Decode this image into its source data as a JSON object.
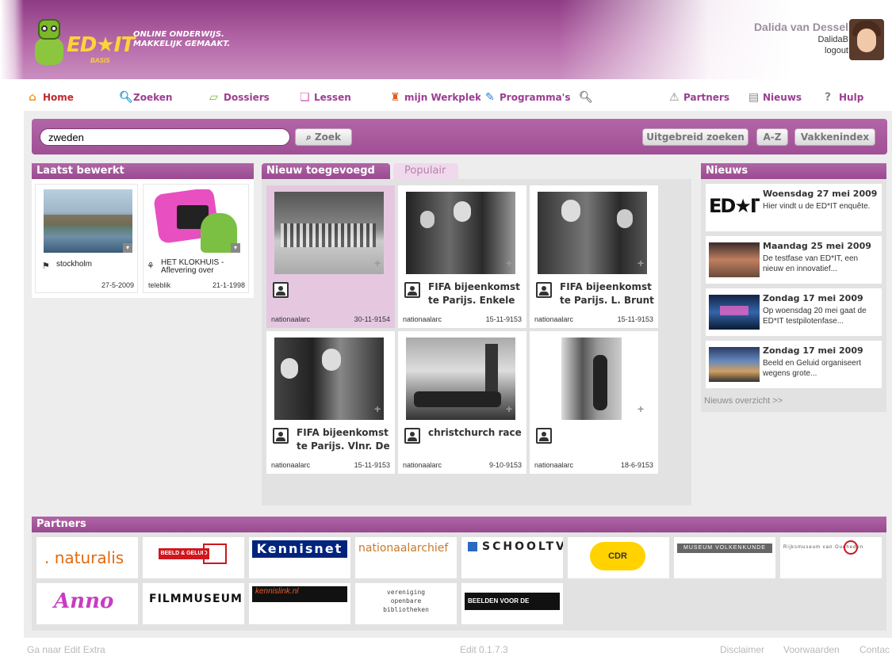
{
  "header": {
    "logo_text": "ED★IT",
    "logo_sub": "BASIS",
    "tagline_1": "ONLINE ONDERWIJS.",
    "tagline_2": "MAKKELIJK GEMAAKT.",
    "user_name": "Dalida van Dessel",
    "user_login": "DalidaB",
    "logout_label": "logout"
  },
  "tabs": [
    {
      "label": "Home",
      "icon": "house-icon"
    },
    {
      "label": "Zoeken",
      "icon": "magnifier-icon"
    },
    {
      "label": "Dossiers",
      "icon": "dossier-icon"
    },
    {
      "label": "Lessen",
      "icon": "lessons-icon"
    },
    {
      "label": "mijn Werkplek",
      "icon": "desk-chair-icon"
    },
    {
      "label": "Programma's",
      "icon": "wrench-icon"
    },
    {
      "label": "",
      "icon": "magnifier-icon"
    },
    {
      "label": "Partners",
      "icon": "partners-icon"
    },
    {
      "label": "Nieuws",
      "icon": "newspaper-icon"
    },
    {
      "label": "Hulp",
      "icon": "question-icon"
    }
  ],
  "search": {
    "value": "zweden",
    "button": "Zoek",
    "advanced": "Uitgebreid zoeken",
    "az": "A-Z",
    "subject_index": "Vakkenindex"
  },
  "recent": {
    "heading": "Laatst bewerkt",
    "items": [
      {
        "title": "stockholm",
        "source": "",
        "date": "27-5-2009"
      },
      {
        "title": "HET KLOKHUIS - Aflevering over",
        "source": "teleblik",
        "date": "21-1-1998"
      }
    ]
  },
  "center": {
    "tab_new": "Nieuw toegevoegd",
    "tab_popular": "Populair",
    "items": [
      {
        "caption": "",
        "source": "nationaalarc",
        "date": "30-11-9154"
      },
      {
        "caption": "FIFA bijeenkomst te Parijs. Enkele",
        "source": "nationaalarc",
        "date": "15-11-9153"
      },
      {
        "caption": "FIFA bijeenkomst te Parijs. L. Brunt",
        "source": "nationaalarc",
        "date": "15-11-9153"
      },
      {
        "caption": "FIFA bijeenkomst te Parijs. Vlnr. De",
        "source": "nationaalarc",
        "date": "15-11-9153"
      },
      {
        "caption": "christchurch race",
        "source": "nationaalarc",
        "date": "9-10-9153"
      },
      {
        "caption": "",
        "source": "nationaalarc",
        "date": "18-6-9153"
      }
    ]
  },
  "news": {
    "heading": "Nieuws",
    "items": [
      {
        "date": "Woensdag 27 mei 2009",
        "text": "Hier vindt u de ED*IT enquête."
      },
      {
        "date": "Maandag 25 mei 2009",
        "text": "De testfase van ED*IT, een nieuw en innovatief..."
      },
      {
        "date": "Zondag 17 mei 2009",
        "text": "Op woensdag 20 mei gaat de ED*IT testpilotenfase..."
      },
      {
        "date": "Zondag 17 mei 2009",
        "text": "Beeld en Geluid organiseert wegens grote..."
      }
    ],
    "overview": "Nieuws overzicht >>"
  },
  "partners": {
    "heading": "Partners",
    "items": [
      ". naturalis",
      "BEELD & GELUID",
      "Kennisnet",
      "nationaalarchief",
      "SCHOOLTV",
      "CDR",
      "MUSEUM VOLKENKUNDE",
      "Rijksmuseum van Oudheden",
      "Anno",
      "FILMMUSEUM",
      "kennislink.nl",
      "vereniging openbare bibliotheken",
      "BEELDEN VOOR DE TOEKOMST"
    ]
  },
  "footer": {
    "left": "Ga naar Edit Extra",
    "version": "Edit 0.1.7.3",
    "disclaimer": "Disclaimer",
    "terms": "Voorwaarden",
    "contact": "Contac"
  },
  "colors": {
    "brand_purple": "#9b3e92",
    "logo_yellow": "#ffd23a",
    "header_purple": "#8e3b84"
  }
}
